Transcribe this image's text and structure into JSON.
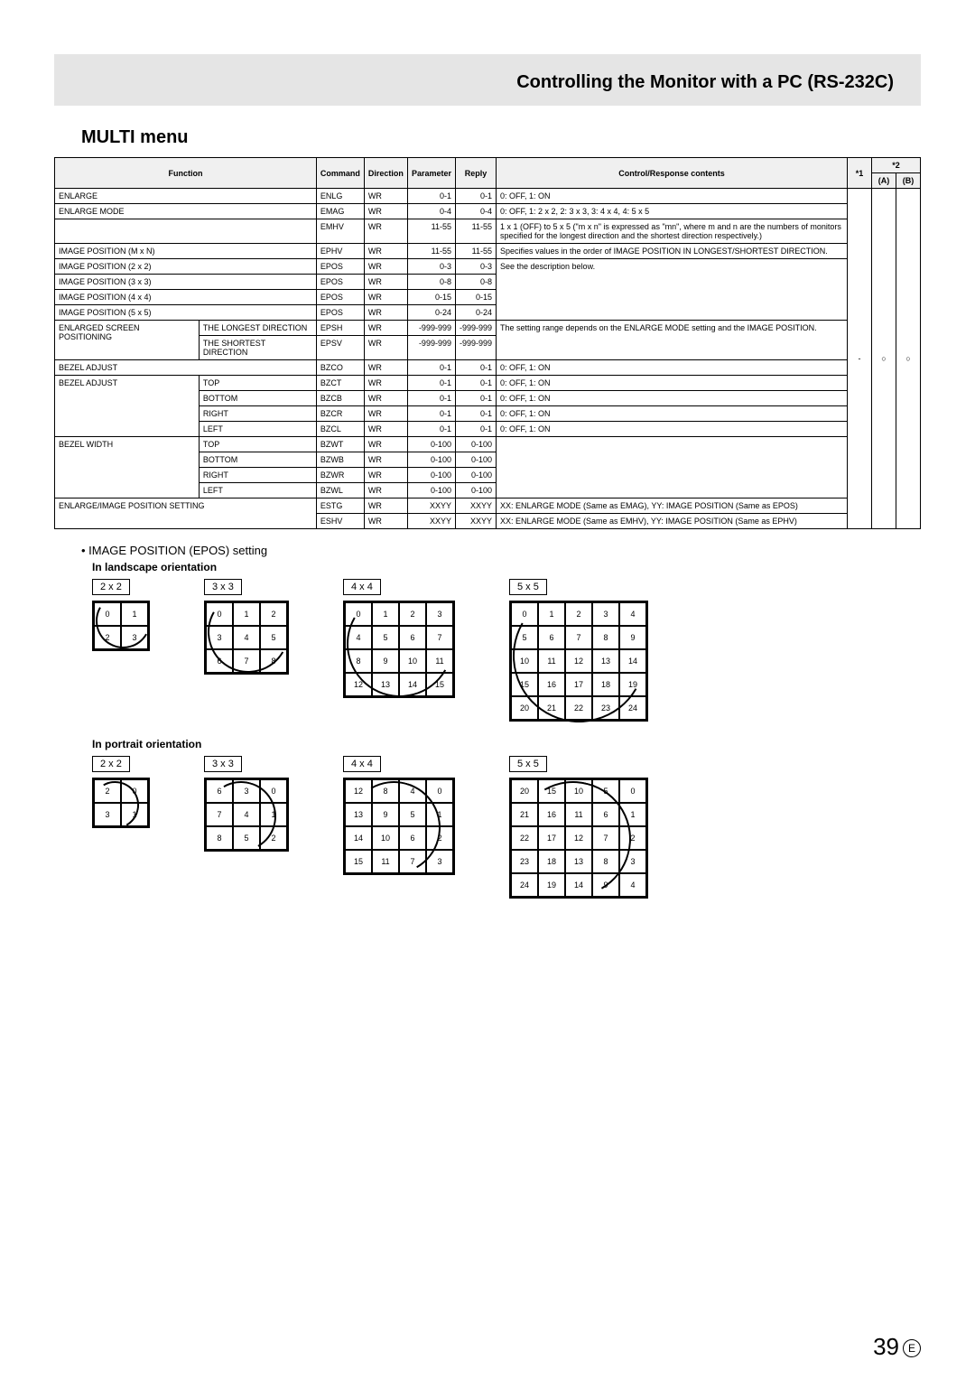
{
  "header": "Controlling the Monitor with a PC (RS-232C)",
  "section": "MULTI menu",
  "th": {
    "function": "Function",
    "command": "Command",
    "direction": "Direction",
    "parameter": "Parameter",
    "reply": "Reply",
    "contents": "Control/Response contents",
    "s1": "*1",
    "s2": "*2",
    "a": "(A)",
    "b": "(B)"
  },
  "rows": [
    {
      "f": "ENLARGE",
      "sub": "",
      "cmd": "ENLG",
      "dir": "WR",
      "param": "0-1",
      "rep": "0-1",
      "con": "0: OFF, 1: ON"
    },
    {
      "f": "ENLARGE MODE",
      "sub": "",
      "cmd": "EMAG",
      "dir": "WR",
      "param": "0-4",
      "rep": "0-4",
      "con": "0: OFF, 1: 2 x 2, 2: 3 x 3, 3: 4 x 4, 4: 5 x 5",
      "rowspan": 1
    },
    {
      "f": "",
      "sub": "",
      "cmd": "EMHV",
      "dir": "WR",
      "param": "11-55",
      "rep": "11-55",
      "con": "1 x 1 (OFF) to 5 x 5 (\"m x n\" is expressed as \"mn\", where m and n are the numbers of monitors specified for the longest direction and the shortest direction respectively.)"
    },
    {
      "f": "IMAGE POSITION (M x N)",
      "sub": "",
      "cmd": "EPHV",
      "dir": "WR",
      "param": "11-55",
      "rep": "11-55",
      "con": "Specifies values in the order of IMAGE POSITION IN LONGEST/SHORTEST DIRECTION."
    },
    {
      "f": "IMAGE POSITION (2 x 2)",
      "sub": "",
      "cmd": "EPOS",
      "dir": "WR",
      "param": "0-3",
      "rep": "0-3",
      "con": "See the description below.",
      "conrowspan": 4
    },
    {
      "f": "IMAGE POSITION (3 x 3)",
      "sub": "",
      "cmd": "EPOS",
      "dir": "WR",
      "param": "0-8",
      "rep": "0-8"
    },
    {
      "f": "IMAGE POSITION (4 x 4)",
      "sub": "",
      "cmd": "EPOS",
      "dir": "WR",
      "param": "0-15",
      "rep": "0-15"
    },
    {
      "f": "IMAGE POSITION (5 x 5)",
      "sub": "",
      "cmd": "EPOS",
      "dir": "WR",
      "param": "0-24",
      "rep": "0-24"
    },
    {
      "f": "ENLARGED SCREEN POSITIONING",
      "frows": 2,
      "sub": "THE LONGEST DIRECTION",
      "cmd": "EPSH",
      "dir": "WR",
      "param": "-999-999",
      "rep": "-999-999",
      "con": "The setting range depends on the ENLARGE MODE setting and the IMAGE POSITION.",
      "conrowspan": 2
    },
    {
      "sub": "THE SHORTEST DIRECTION",
      "cmd": "EPSV",
      "dir": "WR",
      "param": "-999-999",
      "rep": "-999-999"
    },
    {
      "f": "BEZEL ADJUST",
      "sub": "",
      "cmd": "BZCO",
      "dir": "WR",
      "param": "0-1",
      "rep": "0-1",
      "con": "0: OFF, 1: ON"
    },
    {
      "f": "BEZEL ADJUST",
      "frows": 4,
      "sub": "TOP",
      "cmd": "BZCT",
      "dir": "WR",
      "param": "0-1",
      "rep": "0-1",
      "con": "0: OFF, 1: ON"
    },
    {
      "sub": "BOTTOM",
      "cmd": "BZCB",
      "dir": "WR",
      "param": "0-1",
      "rep": "0-1",
      "con": "0: OFF, 1: ON"
    },
    {
      "sub": "RIGHT",
      "cmd": "BZCR",
      "dir": "WR",
      "param": "0-1",
      "rep": "0-1",
      "con": "0: OFF, 1: ON"
    },
    {
      "sub": "LEFT",
      "cmd": "BZCL",
      "dir": "WR",
      "param": "0-1",
      "rep": "0-1",
      "con": "0: OFF, 1: ON"
    },
    {
      "f": "BEZEL WIDTH",
      "frows": 4,
      "sub": "TOP",
      "cmd": "BZWT",
      "dir": "WR",
      "param": "0-100",
      "rep": "0-100",
      "con": "",
      "conrowspan": 4
    },
    {
      "sub": "BOTTOM",
      "cmd": "BZWB",
      "dir": "WR",
      "param": "0-100",
      "rep": "0-100"
    },
    {
      "sub": "RIGHT",
      "cmd": "BZWR",
      "dir": "WR",
      "param": "0-100",
      "rep": "0-100"
    },
    {
      "sub": "LEFT",
      "cmd": "BZWL",
      "dir": "WR",
      "param": "0-100",
      "rep": "0-100"
    },
    {
      "f": "ENLARGE/IMAGE POSITION SETTING",
      "frows": 2,
      "fcols": 2,
      "sub": "",
      "cmd": "ESTG",
      "dir": "WR",
      "param": "XXYY",
      "rep": "XXYY",
      "con": "XX: ENLARGE MODE (Same as EMAG), YY: IMAGE POSITION (Same as EPOS)"
    },
    {
      "cmd": "ESHV",
      "dir": "WR",
      "param": "XXYY",
      "rep": "XXYY",
      "con": "XX: ENLARGE MODE (Same as EMHV), YY: IMAGE POSITION (Same as EPHV)"
    }
  ],
  "marks": {
    "s1": "-",
    "a": "○",
    "b": "○"
  },
  "bullet": "•  IMAGE POSITION (EPOS) setting",
  "landscape": "In landscape orientation",
  "portrait": "In portrait orientation",
  "labels": {
    "g2": "2 x 2",
    "g3": "3 x 3",
    "g4": "4 x 4",
    "g5": "5 x 5"
  },
  "grid": {
    "l2": [
      "0",
      "1",
      "2",
      "3"
    ],
    "l3": [
      "0",
      "1",
      "2",
      "3",
      "4",
      "5",
      "6",
      "7",
      "8"
    ],
    "l4": [
      "0",
      "1",
      "2",
      "3",
      "4",
      "5",
      "6",
      "7",
      "8",
      "9",
      "10",
      "11",
      "12",
      "13",
      "14",
      "15"
    ],
    "l5": [
      "0",
      "1",
      "2",
      "3",
      "4",
      "5",
      "6",
      "7",
      "8",
      "9",
      "10",
      "11",
      "12",
      "13",
      "14",
      "15",
      "16",
      "17",
      "18",
      "19",
      "20",
      "21",
      "22",
      "23",
      "24"
    ],
    "p2": [
      "2",
      "0",
      "3",
      "1"
    ],
    "p3": [
      "6",
      "3",
      "0",
      "7",
      "4",
      "1",
      "8",
      "5",
      "2"
    ],
    "p4": [
      "12",
      "8",
      "4",
      "0",
      "13",
      "9",
      "5",
      "1",
      "14",
      "10",
      "6",
      "2",
      "15",
      "11",
      "7",
      "3"
    ],
    "p5": [
      "20",
      "15",
      "10",
      "5",
      "0",
      "21",
      "16",
      "11",
      "6",
      "1",
      "22",
      "17",
      "12",
      "7",
      "2",
      "23",
      "18",
      "13",
      "8",
      "3",
      "24",
      "19",
      "14",
      "9",
      "4"
    ]
  },
  "pagenum": "39",
  "pageletter": "E"
}
